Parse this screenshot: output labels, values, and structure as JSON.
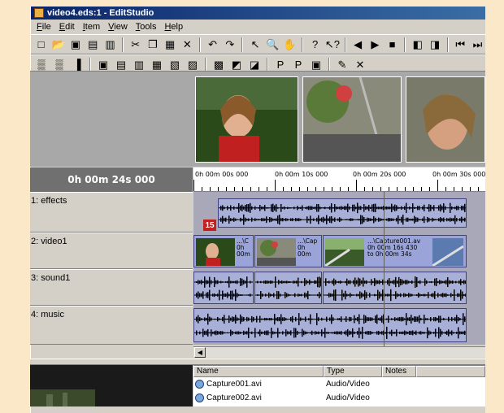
{
  "window": {
    "title": "video4.eds:1 - EditStudio"
  },
  "menu": [
    "File",
    "Edit",
    "Item",
    "View",
    "Tools",
    "Help"
  ],
  "toolbar1": [
    {
      "name": "new-icon",
      "glyph": "□"
    },
    {
      "name": "open-icon",
      "glyph": "📂"
    },
    {
      "name": "save-icon",
      "glyph": "▣"
    },
    {
      "name": "clapper-icon",
      "glyph": "▤"
    },
    {
      "name": "film-icon",
      "glyph": "▥"
    },
    {
      "sep": true
    },
    {
      "name": "cut-icon",
      "glyph": "✂"
    },
    {
      "name": "copy-icon",
      "glyph": "❐"
    },
    {
      "name": "paste-icon",
      "glyph": "▦"
    },
    {
      "name": "delete-icon",
      "glyph": "✕"
    },
    {
      "sep": true
    },
    {
      "name": "undo-icon",
      "glyph": "↶"
    },
    {
      "name": "redo-icon",
      "glyph": "↷"
    },
    {
      "sep": true
    },
    {
      "name": "pointer-icon",
      "glyph": "↖"
    },
    {
      "name": "zoom-icon",
      "glyph": "🔍"
    },
    {
      "name": "hand-icon",
      "glyph": "✋"
    },
    {
      "sep": true
    },
    {
      "name": "help-icon",
      "glyph": "?"
    },
    {
      "name": "context-help-icon",
      "glyph": "↖?"
    },
    {
      "sep": true
    },
    {
      "name": "rewind-icon",
      "glyph": "◀"
    },
    {
      "name": "play-icon",
      "glyph": "▶"
    },
    {
      "name": "stop-icon",
      "glyph": "■"
    },
    {
      "sep": true
    },
    {
      "name": "mark-in-icon",
      "glyph": "◧"
    },
    {
      "name": "mark-out-icon",
      "glyph": "◨"
    },
    {
      "sep": true
    },
    {
      "name": "prev-edit-icon",
      "glyph": "⏮"
    },
    {
      "name": "next-edit-icon",
      "glyph": "⏭"
    }
  ],
  "toolbar2": [
    {
      "name": "track-tool1-icon",
      "glyph": "▒"
    },
    {
      "name": "track-tool2-icon",
      "glyph": "▒"
    },
    {
      "name": "track-tool3-icon",
      "glyph": "▐"
    },
    {
      "sep": true
    },
    {
      "name": "clip-tool1-icon",
      "glyph": "▣"
    },
    {
      "name": "clip-tool2-icon",
      "glyph": "▤"
    },
    {
      "name": "clip-tool3-icon",
      "glyph": "▥"
    },
    {
      "name": "clip-tool4-icon",
      "glyph": "▦"
    },
    {
      "name": "clip-tool5-icon",
      "glyph": "▧"
    },
    {
      "name": "clip-tool6-icon",
      "glyph": "▨"
    },
    {
      "sep": true
    },
    {
      "name": "effect1-icon",
      "glyph": "▩"
    },
    {
      "name": "effect2-icon",
      "glyph": "◩"
    },
    {
      "name": "effect3-icon",
      "glyph": "◪"
    },
    {
      "sep": true
    },
    {
      "name": "title1-icon",
      "glyph": "P"
    },
    {
      "name": "title2-icon",
      "glyph": "P"
    },
    {
      "name": "title3-icon",
      "glyph": "▣"
    },
    {
      "sep": true
    },
    {
      "name": "edit-icon",
      "glyph": "✎"
    },
    {
      "name": "clear-icon",
      "glyph": "✕"
    }
  ],
  "timeline": {
    "current_time": "0h 00m 24s 000",
    "ruler_labels": [
      "0h 00m 00s 000",
      "0h 00m 10s 000",
      "0h 00m 20s 000",
      "0h 00m 30s 000"
    ]
  },
  "tracks": [
    {
      "label": "1: effects"
    },
    {
      "label": "2: video1"
    },
    {
      "label": "3: sound1"
    },
    {
      "label": "4: music"
    }
  ],
  "clips": {
    "video1": [
      {
        "text": "...\\C\n0h\n00m"
      },
      {
        "text": "...\\Cap\n0h\n00m"
      },
      {
        "text": "...\\Capture001.av\n0h 00m 16s 430\nto 0h 00m 34s"
      }
    ]
  },
  "marker": {
    "label": "15"
  },
  "file_list": {
    "columns": [
      "Name",
      "Type",
      "Notes"
    ],
    "rows": [
      {
        "name": "Capture001.avi",
        "type": "Audio/Video"
      },
      {
        "name": "Capture002.avi",
        "type": "Audio/Video"
      }
    ]
  }
}
